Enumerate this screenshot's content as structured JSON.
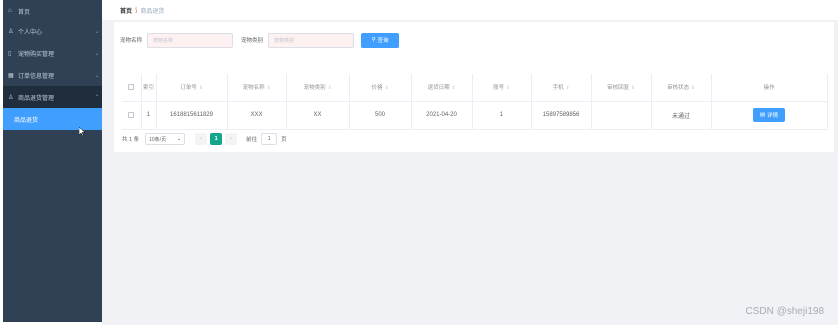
{
  "sidebar": {
    "home": {
      "icon": "home-icon",
      "label": "首页"
    },
    "items": [
      {
        "icon": "user-icon",
        "label": "个人中心"
      },
      {
        "icon": "clipboard-icon",
        "label": "宠物购买管理"
      },
      {
        "icon": "grid-icon",
        "label": "订单信息管理"
      },
      {
        "icon": "user-icon",
        "label": "商品退货管理"
      }
    ],
    "submenu": [
      {
        "label": "商品退货",
        "active": true
      }
    ]
  },
  "breadcrumb": {
    "home": "首页",
    "current": "商品退货"
  },
  "search": {
    "fields": [
      {
        "label": "宠物名称",
        "placeholder": "宠物名称"
      },
      {
        "label": "宠物类别",
        "placeholder": "宠物类别"
      }
    ],
    "query_label": "查询"
  },
  "table": {
    "columns": [
      "索引",
      "订单号",
      "宠物名称",
      "宠物类别",
      "价格",
      "退货日期",
      "账号",
      "手机",
      "审核回复",
      "审核状态",
      "操作"
    ],
    "rows": [
      {
        "index": "1",
        "order_no": "1618815611829",
        "pet_name": "XXX",
        "pet_type": "XX",
        "price": "500",
        "return_date": "2021-04-20",
        "account": "1",
        "phone": "15897589856",
        "review_reply": "",
        "review_status": "未通过",
        "action": "详情"
      }
    ]
  },
  "pagination": {
    "total": "共 1 条",
    "page_size": "10条/页",
    "current_page": "1",
    "goto_label": "前往",
    "goto_value": "1",
    "page_unit": "页"
  },
  "watermark": "CSDN @sheji198",
  "colors": {
    "sidebar_bg": "#304156",
    "accent": "#409eff",
    "pager_active": "#13a68a"
  }
}
